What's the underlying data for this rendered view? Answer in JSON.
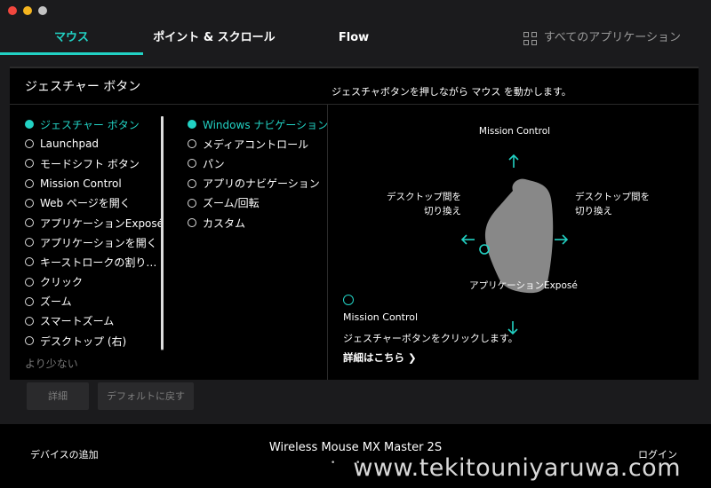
{
  "window": {
    "title": ""
  },
  "tabs": [
    {
      "label": "マウス"
    },
    {
      "label": "ポイント & スクロール"
    },
    {
      "label": "Flow"
    }
  ],
  "all_apps": {
    "label": "すべてのアプリケーション"
  },
  "panel": {
    "title": "ジェスチャー ボタン",
    "description": "ジェスチャボタンを押しながら マウス を動かします。"
  },
  "buttons_list": [
    {
      "label": "ジェスチャー ボタン",
      "selected": true
    },
    {
      "label": "Launchpad"
    },
    {
      "label": "モードシフト ボタン"
    },
    {
      "label": "Mission Control"
    },
    {
      "label": "Web ページを開く"
    },
    {
      "label": "アプリケーションExposé"
    },
    {
      "label": "アプリケーションを開く"
    },
    {
      "label": "キーストロークの割り…"
    },
    {
      "label": "クリック"
    },
    {
      "label": "ズーム"
    },
    {
      "label": "スマートズーム"
    },
    {
      "label": "デスクトップ (右)"
    }
  ],
  "show_less": "より少ない",
  "gesture_options": [
    {
      "label": "Windows ナビゲーション",
      "selected": true
    },
    {
      "label": "メディアコントロール"
    },
    {
      "label": "パン"
    },
    {
      "label": "アプリのナビゲーション"
    },
    {
      "label": "ズーム/回転"
    },
    {
      "label": "カスタム"
    }
  ],
  "diagram": {
    "top": "Mission Control",
    "left": "デスクトップ間を\n切り換え",
    "right": "デスクトップ間を\n切り換え",
    "bottom": "アプリケーションExposé",
    "accent": "#22d2c4"
  },
  "info": {
    "title": "Mission Control",
    "subtitle": "ジェスチャーボタンをクリックします。",
    "link": "詳細はこちら ❯"
  },
  "actions": {
    "details": "詳細",
    "reset": "デフォルトに戻す"
  },
  "footer": {
    "add_device": "デバイスの追加",
    "device_name": "Wireless Mouse MX Master 2S",
    "login": "ログイン",
    "watermark": "www.tekitouniyaruwa.com"
  }
}
